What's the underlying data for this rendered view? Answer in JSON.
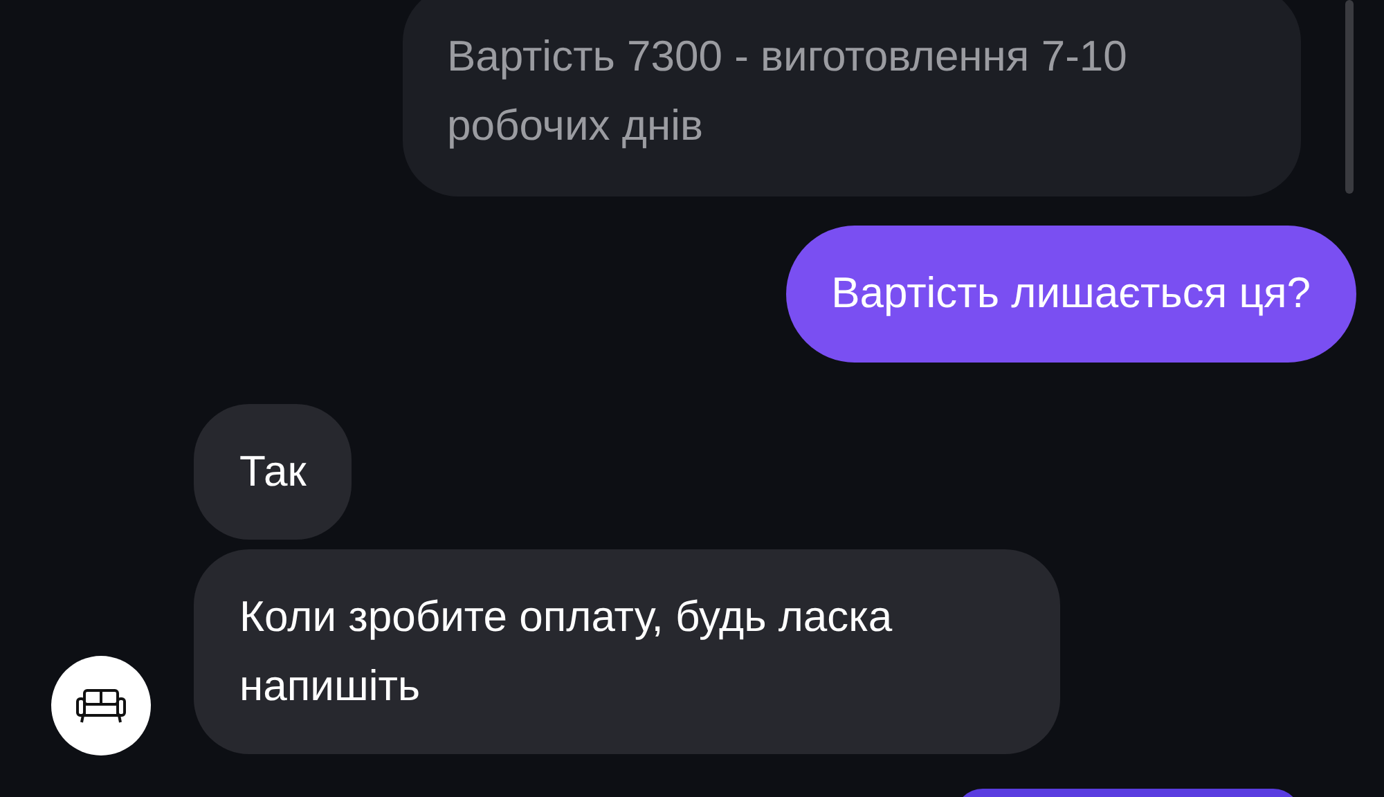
{
  "messages": [
    {
      "kind": "quoted",
      "text": "Вартість 7300 - виготовлення 7-10 робочих днів",
      "show_avatar": false
    },
    {
      "kind": "outgoing",
      "text": "Вартість лишається ця?",
      "show_avatar": false
    },
    {
      "kind": "incoming",
      "text": "Так",
      "show_avatar": false
    },
    {
      "kind": "incoming",
      "text": "Коли зробите оплату, будь ласка напишіть",
      "show_avatar": true
    }
  ]
}
